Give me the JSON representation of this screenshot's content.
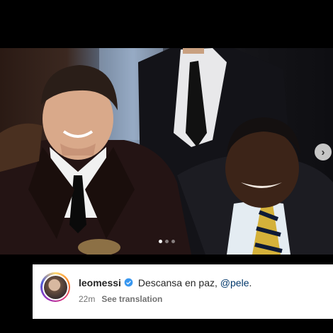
{
  "post": {
    "username": "leomessi",
    "caption_text": " Descansa en paz, ",
    "mention": "@pele",
    "caption_end": ".",
    "time_ago": "22m",
    "see_translation": "See translation"
  },
  "carousel": {
    "slide_count": 3,
    "active_slide": 1,
    "next_icon": "chevron-right-icon"
  },
  "colors": {
    "mention": "#00376b",
    "verified": "#3897f0",
    "meta_text": "#737373"
  }
}
